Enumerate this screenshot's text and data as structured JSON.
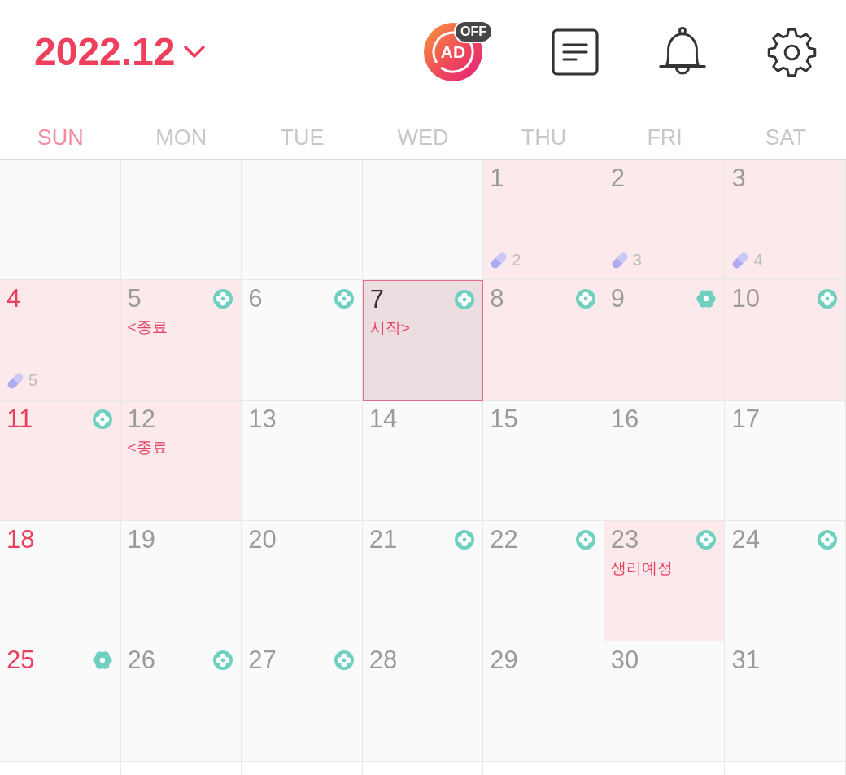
{
  "header": {
    "month": "2022.12",
    "ad_label": "AD",
    "ad_status": "OFF"
  },
  "weekdays": [
    {
      "label": "SUN",
      "kind": "sunday"
    },
    {
      "label": "MON",
      "kind": "weekday"
    },
    {
      "label": "TUE",
      "kind": "weekday"
    },
    {
      "label": "WED",
      "kind": "weekday"
    },
    {
      "label": "THU",
      "kind": "weekday"
    },
    {
      "label": "FRI",
      "kind": "weekday"
    },
    {
      "label": "SAT",
      "kind": "weekday"
    }
  ],
  "weeks": [
    [
      {
        "kind": "blank"
      },
      {
        "kind": "blank"
      },
      {
        "kind": "blank"
      },
      {
        "kind": "blank"
      },
      {
        "kind": "day",
        "day": "1",
        "period": true,
        "selected": false,
        "pill": "2"
      },
      {
        "kind": "day",
        "day": "2",
        "period": true,
        "selected": false,
        "pill": "3"
      },
      {
        "kind": "day",
        "day": "3",
        "period": true,
        "selected": false,
        "pill": "4"
      }
    ],
    [
      {
        "kind": "day",
        "day": "4",
        "period": true,
        "selected": false,
        "pill": "5"
      },
      {
        "kind": "day",
        "day": "5",
        "period": true,
        "selected": false,
        "marker": {
          "kind": "fertile"
        },
        "note": "<종료"
      },
      {
        "kind": "day",
        "day": "6",
        "period": false,
        "selected": false,
        "marker": {
          "kind": "fertile"
        }
      },
      {
        "kind": "day",
        "day": "7",
        "period": true,
        "selected": true,
        "marker": {
          "kind": "fertile"
        },
        "note": "시작>"
      },
      {
        "kind": "day",
        "day": "8",
        "period": true,
        "selected": false,
        "marker": {
          "kind": "fertile"
        }
      },
      {
        "kind": "day",
        "day": "9",
        "period": true,
        "selected": false,
        "marker": {
          "kind": "ovulation"
        }
      },
      {
        "kind": "day",
        "day": "10",
        "period": true,
        "selected": false,
        "marker": {
          "kind": "fertile"
        }
      }
    ],
    [
      {
        "kind": "day",
        "day": "11",
        "period": true,
        "selected": false,
        "marker": {
          "kind": "fertile"
        }
      },
      {
        "kind": "day",
        "day": "12",
        "period": true,
        "selected": false,
        "note": "<종료"
      },
      {
        "kind": "day",
        "day": "13",
        "period": false,
        "selected": false
      },
      {
        "kind": "day",
        "day": "14",
        "period": false,
        "selected": false
      },
      {
        "kind": "day",
        "day": "15",
        "period": false,
        "selected": false
      },
      {
        "kind": "day",
        "day": "16",
        "period": false,
        "selected": false
      },
      {
        "kind": "day",
        "day": "17",
        "period": false,
        "selected": false
      }
    ],
    [
      {
        "kind": "day",
        "day": "18",
        "period": false,
        "selected": false
      },
      {
        "kind": "day",
        "day": "19",
        "period": false,
        "selected": false
      },
      {
        "kind": "day",
        "day": "20",
        "period": false,
        "selected": false
      },
      {
        "kind": "day",
        "day": "21",
        "period": false,
        "selected": false,
        "marker": {
          "kind": "fertile"
        }
      },
      {
        "kind": "day",
        "day": "22",
        "period": false,
        "selected": false,
        "marker": {
          "kind": "fertile"
        }
      },
      {
        "kind": "day",
        "day": "23",
        "period": true,
        "selected": false,
        "marker": {
          "kind": "fertile"
        },
        "note": "생리예정"
      },
      {
        "kind": "day",
        "day": "24",
        "period": false,
        "selected": false,
        "marker": {
          "kind": "fertile"
        }
      }
    ],
    [
      {
        "kind": "day",
        "day": "25",
        "period": false,
        "selected": false,
        "marker": {
          "kind": "ovulation"
        }
      },
      {
        "kind": "day",
        "day": "26",
        "period": false,
        "selected": false,
        "marker": {
          "kind": "fertile"
        }
      },
      {
        "kind": "day",
        "day": "27",
        "period": false,
        "selected": false,
        "marker": {
          "kind": "fertile"
        }
      },
      {
        "kind": "day",
        "day": "28",
        "period": false,
        "selected": false
      },
      {
        "kind": "day",
        "day": "29",
        "period": false,
        "selected": false
      },
      {
        "kind": "day",
        "day": "30",
        "period": false,
        "selected": false
      },
      {
        "kind": "day",
        "day": "31",
        "period": false,
        "selected": false
      }
    ]
  ]
}
